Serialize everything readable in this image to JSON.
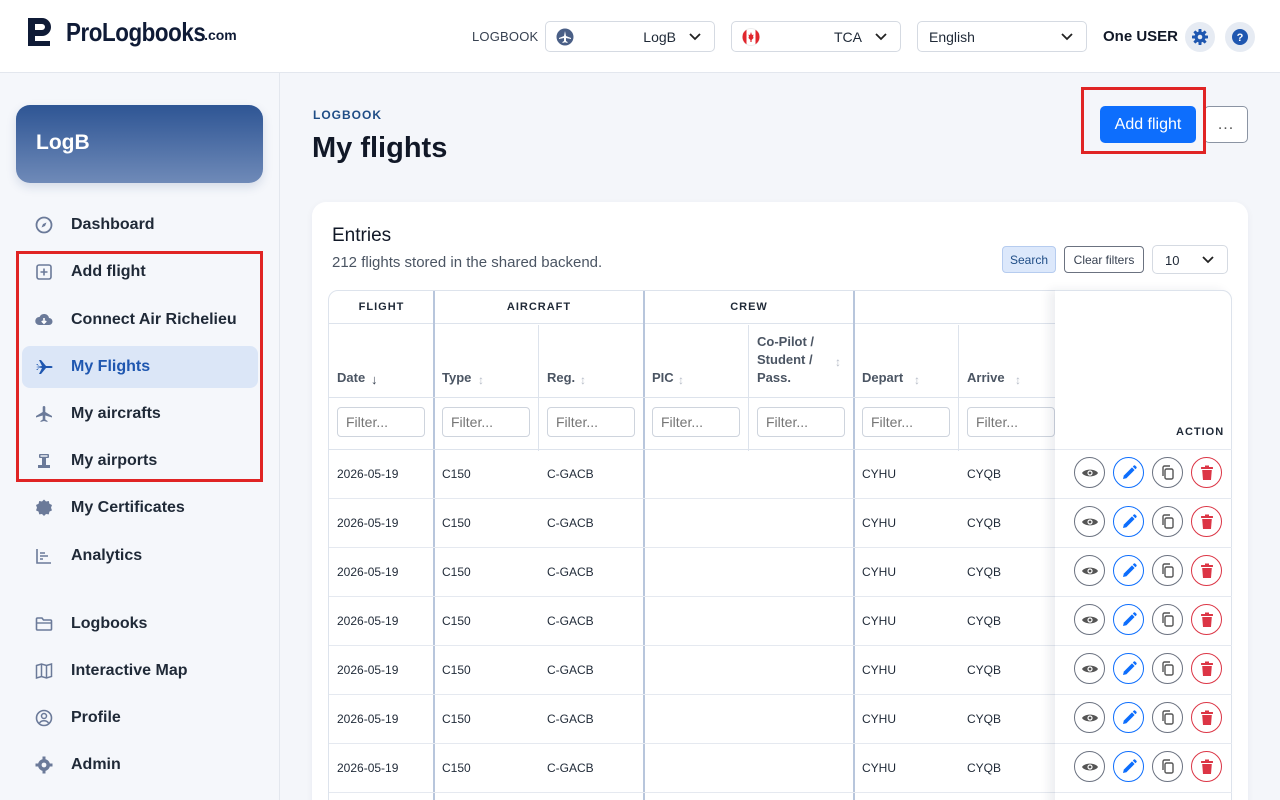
{
  "app": {
    "logo_text": "ProLogbooks",
    "logo_suffix": ".com"
  },
  "topbar": {
    "logbook_label": "LOGBOOK",
    "logbook_value": "LogB",
    "region_value": "TCA",
    "language_value": "English",
    "user_name": "One USER"
  },
  "sidebar": {
    "logbook_card": "LogB",
    "items": [
      {
        "label": "Dashboard",
        "icon": "compass-icon"
      },
      {
        "label": "Add flight",
        "icon": "plus-square-icon"
      },
      {
        "label": "Connect Air Richelieu",
        "icon": "cloud-download-icon"
      },
      {
        "label": "My Flights",
        "icon": "airplane-icon"
      },
      {
        "label": "My aircrafts",
        "icon": "aircraft-icon"
      },
      {
        "label": "My airports",
        "icon": "airport-icon"
      },
      {
        "label": "My Certificates",
        "icon": "badge-icon"
      },
      {
        "label": "Analytics",
        "icon": "bar-chart-icon"
      },
      {
        "label": "Logbooks",
        "icon": "folder-icon"
      },
      {
        "label": "Interactive Map",
        "icon": "map-icon"
      },
      {
        "label": "Profile",
        "icon": "user-circle-icon"
      },
      {
        "label": "Admin",
        "icon": "gear-icon"
      }
    ]
  },
  "main": {
    "eyebrow": "LOGBOOK",
    "title": "My flights",
    "add_flight": "Add flight",
    "more": "...",
    "entries_title": "Entries",
    "entries_sub": "212 flights stored in the shared backend.",
    "search_btn": "Search",
    "clear_btn": "Clear filters",
    "page_size": "10"
  },
  "table": {
    "groups": {
      "flight": "FLIGHT",
      "aircraft": "AIRCRAFT",
      "crew": "CREW"
    },
    "columns": {
      "date": "Date",
      "type": "Type",
      "reg": "Reg.",
      "pic": "PIC",
      "copilot_1": "Co-Pilot /",
      "copilot_2": "Student /",
      "copilot_3": "Pass.",
      "depart": "Depart",
      "arrive": "Arrive",
      "action": "ACTION"
    },
    "filter_placeholder": "Filter...",
    "rows": [
      {
        "date": "2026-05-19",
        "type": "C150",
        "reg": "C-GACB",
        "pic": "",
        "copilot": "",
        "depart": "CYHU",
        "arrive": "CYQB"
      },
      {
        "date": "2026-05-19",
        "type": "C150",
        "reg": "C-GACB",
        "pic": "",
        "copilot": "",
        "depart": "CYHU",
        "arrive": "CYQB"
      },
      {
        "date": "2026-05-19",
        "type": "C150",
        "reg": "C-GACB",
        "pic": "",
        "copilot": "",
        "depart": "CYHU",
        "arrive": "CYQB"
      },
      {
        "date": "2026-05-19",
        "type": "C150",
        "reg": "C-GACB",
        "pic": "",
        "copilot": "",
        "depart": "CYHU",
        "arrive": "CYQB"
      },
      {
        "date": "2026-05-19",
        "type": "C150",
        "reg": "C-GACB",
        "pic": "",
        "copilot": "",
        "depart": "CYHU",
        "arrive": "CYQB"
      },
      {
        "date": "2026-05-19",
        "type": "C150",
        "reg": "C-GACB",
        "pic": "",
        "copilot": "",
        "depart": "CYHU",
        "arrive": "CYQB"
      },
      {
        "date": "2026-05-19",
        "type": "C150",
        "reg": "C-GACB",
        "pic": "",
        "copilot": "",
        "depart": "CYHU",
        "arrive": "CYQB"
      }
    ]
  },
  "colors": {
    "accent": "#0d6efd",
    "danger": "#dc3545",
    "highlight": "#e02424",
    "nav_active": "#dbe6f7"
  }
}
